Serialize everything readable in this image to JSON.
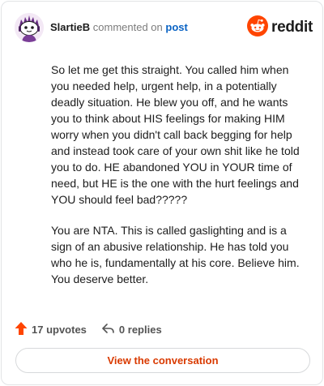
{
  "header": {
    "author": "SlartieB",
    "action_text": "commented on",
    "post_link_label": "post",
    "brand_name": "reddit"
  },
  "comment": {
    "paragraphs": [
      "So let me get this straight. You called him when you needed help, urgent help, in a potentially deadly situation. He blew you off, and he wants you to think about HIS feelings for making HIM worry when you didn't call back begging for help and instead took care of your own shit like he told you to do. HE abandoned YOU in YOUR time of need, but HE is the one with the hurt feelings and YOU should feel bad?????",
      "You are NTA. This is called gaslighting and is a sign of an abusive relationship. He has told you who he is, fundamentally at his core. Believe him. You deserve better."
    ]
  },
  "footer": {
    "upvotes_label": "17 upvotes",
    "replies_label": "0 replies"
  },
  "cta": {
    "label": "View the conversation"
  },
  "icons": {
    "brand": "reddit-logo-icon",
    "avatar": "snoo-avatar-icon",
    "upvote": "upvote-arrow-icon",
    "reply": "reply-arrow-icon"
  },
  "colors": {
    "brand_orange": "#ff4500",
    "upvote_orange": "#ff4500",
    "link_blue": "#0a63c4",
    "cta_text": "#d93a00",
    "text_primary": "#1c1c1c",
    "text_muted": "#7c7c7c",
    "border": "#e2e4e6"
  }
}
